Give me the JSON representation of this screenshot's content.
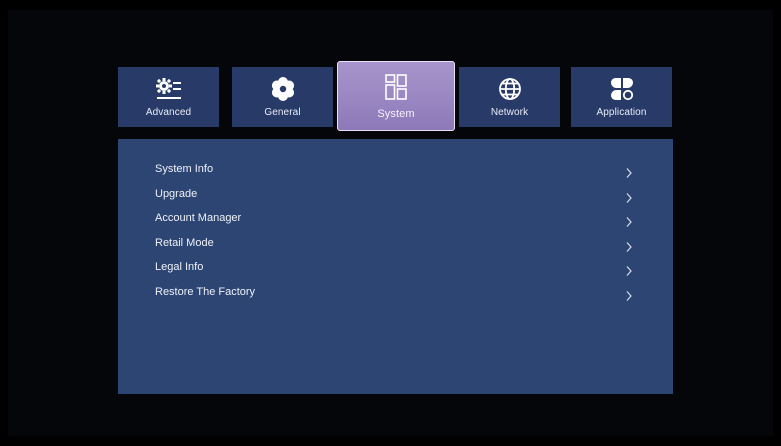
{
  "tabs": [
    {
      "label": "Advanced",
      "icon": "settings-list-icon",
      "active": false
    },
    {
      "label": "General",
      "icon": "flower-gear-icon",
      "active": false
    },
    {
      "label": "System",
      "icon": "windows-grid-icon",
      "active": true
    },
    {
      "label": "Network",
      "icon": "globe-icon",
      "active": false
    },
    {
      "label": "Application",
      "icon": "apps-icon",
      "active": false
    }
  ],
  "menu": {
    "items": [
      {
        "label": "System Info"
      },
      {
        "label": "Upgrade"
      },
      {
        "label": "Account Manager"
      },
      {
        "label": "Retail Mode"
      },
      {
        "label": "Legal Info"
      },
      {
        "label": "Restore The Factory"
      }
    ]
  },
  "colors": {
    "background": "#000000",
    "tab": "#283a68",
    "tab_active": "#9e89c4",
    "panel": "#2d4573",
    "text": "#eef1f8"
  }
}
